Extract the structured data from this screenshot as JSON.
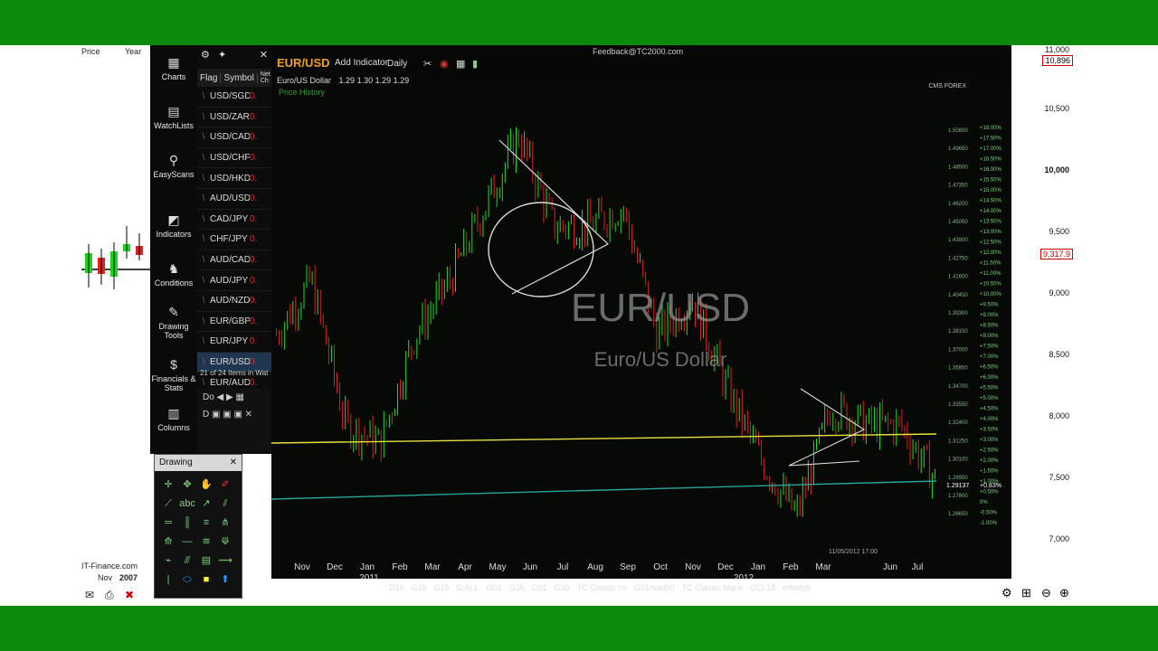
{
  "background_app_left": {
    "label_price": "Price",
    "label_year": "Year",
    "provider": "IT-Finance.com",
    "axis_month": "Nov",
    "axis_year": "2007"
  },
  "background_app_right": {
    "price_labels": [
      "11,000",
      "10,896",
      "10,500",
      "10,000",
      "9,500",
      "9,317.9",
      "9,000",
      "8,500",
      "8,000",
      "7,500",
      "7,000"
    ],
    "highlight_color": "#cc0000"
  },
  "nav": {
    "items": [
      {
        "label": "Charts",
        "icon": "chart-icon"
      },
      {
        "label": "WatchLists",
        "icon": "watchlist-icon"
      },
      {
        "label": "EasyScans",
        "icon": "scan-icon"
      },
      {
        "label": "Indicators",
        "icon": "indicator-icon"
      },
      {
        "label": "Conditions",
        "icon": "conditions-icon"
      },
      {
        "label": "Drawing Tools",
        "icon": "drawing-icon"
      },
      {
        "label": "Financials & Stats",
        "icon": "financials-icon"
      },
      {
        "label": "Columns",
        "icon": "columns-icon"
      }
    ]
  },
  "watchlist": {
    "headers": [
      "Flag",
      "Symbol",
      "Net Ch"
    ],
    "rows": [
      "USD/SGD",
      "USD/ZAR",
      "USD/CAD",
      "USD/CHF",
      "USD/HKD",
      "AUD/USD",
      "CAD/JPY",
      "CHF/JPY",
      "AUD/CAD",
      "AUD/JPY",
      "AUD/NZD",
      "EUR/GBP",
      "EUR/JPY",
      "EUR/USD",
      "EUR/AUD"
    ],
    "selected": "EUR/USD",
    "footer": "21 of 24 Items in Wat"
  },
  "chart": {
    "feedback": "Feedback@TC2000.com",
    "symbol": "EUR/USD",
    "add_indicator": "Add Indicator",
    "period": "Daily",
    "ohlc_name": "Euro/US Dollar",
    "ohlc_values": "1.29  1.30  1.29  1.29",
    "price_history": "Price History",
    "watermark_symbol": "EUR/USD",
    "watermark_name": "Euro/US Dollar",
    "data_source": "CMS FOREX",
    "date_readout": "11/05/2012 17:00",
    "colors": {
      "up": "#22dd22",
      "down": "#dd2222",
      "yellow_line": "#e8e040",
      "teal_line": "#2aa59a"
    }
  },
  "chart_data": {
    "type": "candlestick",
    "title": "EUR/USD",
    "subtitle": "Euro/US Dollar",
    "x_labels": [
      "Nov",
      "Dec",
      "Jan",
      "Feb",
      "Mar",
      "Apr",
      "May",
      "Jun",
      "Jul",
      "Aug",
      "Sep",
      "Oct",
      "Nov",
      "Dec",
      "Jan",
      "Feb",
      "Mar",
      "Jun",
      "Jul"
    ],
    "year_labels": [
      "2011",
      "2012"
    ],
    "series": [
      {
        "name": "EUR/USD",
        "x": [
          "2010-10",
          "2010-11",
          "2010-12",
          "2011-01",
          "2011-02",
          "2011-03",
          "2011-04",
          "2011-05",
          "2011-06",
          "2011-07",
          "2011-08",
          "2011-09",
          "2011-10",
          "2011-11",
          "2011-12",
          "2012-01",
          "2012-02",
          "2012-03",
          "2012-04",
          "2012-05"
        ],
        "values": [
          1.37,
          1.4,
          1.32,
          1.31,
          1.37,
          1.4,
          1.44,
          1.48,
          1.43,
          1.43,
          1.44,
          1.37,
          1.39,
          1.34,
          1.3,
          1.27,
          1.33,
          1.32,
          1.32,
          1.29
        ]
      }
    ],
    "ylim": [
      1.25,
      1.5
    ],
    "y_ticks": [
      "1.50800",
      "1.49650",
      "1.48500",
      "1.47350",
      "1.46200",
      "1.45050",
      "1.43900",
      "1.42750",
      "1.41600",
      "1.40450",
      "1.39300",
      "1.38150",
      "1.37000",
      "1.35850",
      "1.34700",
      "1.33550",
      "1.32400",
      "1.31250",
      "1.30100",
      "1.28950",
      "1.27800",
      "1.26650"
    ],
    "pct_ticks": [
      "+18.00%",
      "+17.50%",
      "+17.00%",
      "+16.50%",
      "+16.00%",
      "+15.50%",
      "+15.00%",
      "+14.50%",
      "+14.00%",
      "+13.50%",
      "+13.00%",
      "+12.50%",
      "+12.00%",
      "+11.50%",
      "+11.00%",
      "+10.50%",
      "+10.00%",
      "+9.50%",
      "+9.00%",
      "+8.50%",
      "+8.00%",
      "+7.50%",
      "+7.00%",
      "+6.50%",
      "+6.00%",
      "+5.50%",
      "+5.00%",
      "+4.50%",
      "+4.00%",
      "+3.50%",
      "+3.00%",
      "+2.50%",
      "+2.00%",
      "+1.50%",
      "+1.00%",
      "+0.50%",
      "0%",
      "-0.50%",
      "-1.00%"
    ],
    "last_price": "1.29137",
    "last_pct": "+0.83%",
    "horizontal_lines": [
      {
        "price": 1.31,
        "color": "#e8e040"
      },
      {
        "price": 1.279,
        "color": "#2aa59a"
      }
    ]
  },
  "drawing_toolbar": {
    "title": "Drawing"
  },
  "layout_tabs": [
    "D10",
    "G15",
    "G15",
    "G ALL",
    "G01",
    "G35",
    "G01",
    "G35",
    "TC Classic rsi",
    "G01mad50",
    "TC Classic blank",
    "CCI 18",
    "infinity8"
  ]
}
